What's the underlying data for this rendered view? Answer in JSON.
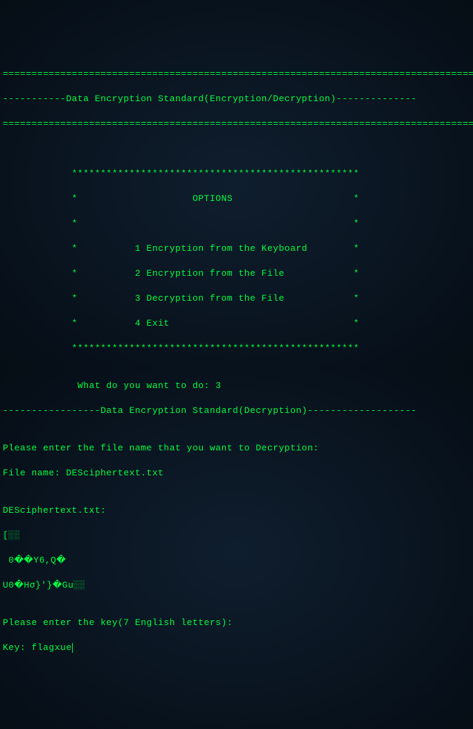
{
  "border_top": "====================================================================================",
  "header": "-----------Data Encryption Standard(Encryption/Decryption)--------------",
  "border_bottom": "====================================================================================",
  "blank": "",
  "options_box": {
    "top": "            **************************************************",
    "title": "            *                    OPTIONS                     *",
    "spacer": "            *                                                *",
    "opt1": "            *          1 Encryption from the Keyboard        *",
    "opt2": "            *          2 Encryption from the File            *",
    "opt3": "            *          3 Decryption from the File            *",
    "opt4": "            *          4 Exit                                *",
    "bottom": "            **************************************************"
  },
  "prompt_choice_label": "             What do you want to do: ",
  "prompt_choice_value": "3",
  "sub_header": "-----------------Data Encryption Standard(Decryption)-------------------",
  "file_prompt": "Please enter the file name that you want to Decryption:",
  "file_label": "File name: ",
  "file_value": "DESciphertext.txt",
  "file_echo": "DESciphertext.txt:",
  "cipher_line1": "[░░",
  "cipher_line2": " 0��Y6,Q�",
  "cipher_line3": "U0�Hσ}'}�Gu░░",
  "key_prompt": "Please enter the key(7 English letters):",
  "key_label": "Key: ",
  "key_value": "flagxue"
}
